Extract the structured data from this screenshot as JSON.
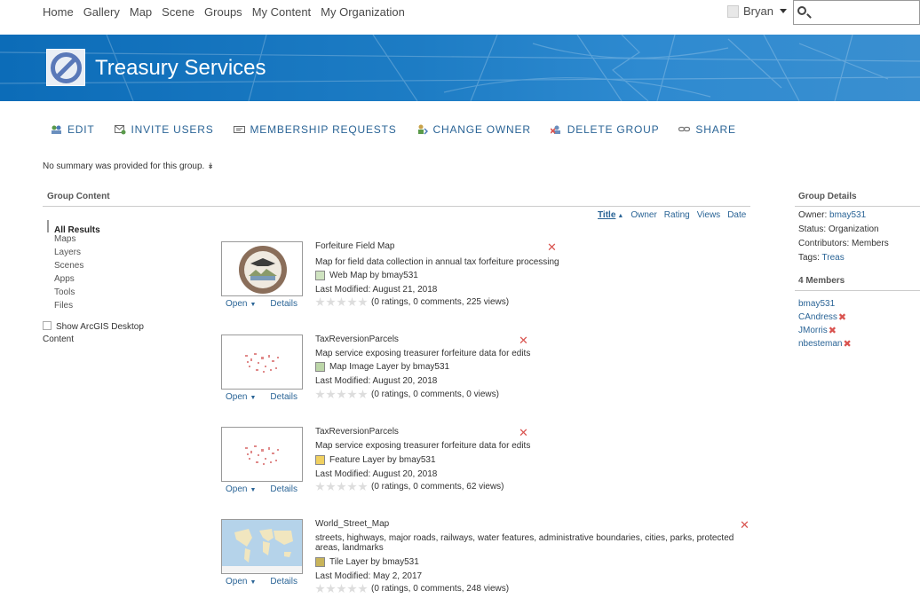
{
  "nav": {
    "links": [
      "Home",
      "Gallery",
      "Map",
      "Scene",
      "Groups",
      "My Content",
      "My Organization"
    ],
    "user": "Bryan",
    "search_value": ""
  },
  "banner": {
    "title": "Treasury Services",
    "color": "#1d7cc4"
  },
  "actions": [
    {
      "label": "EDIT",
      "icon": "edit-icon"
    },
    {
      "label": "INVITE USERS",
      "icon": "invite-icon"
    },
    {
      "label": "MEMBERSHIP REQUESTS",
      "icon": "requests-icon"
    },
    {
      "label": "CHANGE OWNER",
      "icon": "change-owner-icon"
    },
    {
      "label": "DELETE GROUP",
      "icon": "delete-group-icon"
    },
    {
      "label": "SHARE",
      "icon": "share-icon"
    }
  ],
  "summary": "No summary was provided for this group.",
  "group_content": {
    "heading": "Group Content",
    "filter_active": "All Results",
    "filters": [
      "Maps",
      "Layers",
      "Scenes",
      "Apps",
      "Tools",
      "Files"
    ],
    "show_desktop": "Show ArcGIS Desktop Content",
    "sort": [
      "Title",
      "Owner",
      "Rating",
      "Views",
      "Date"
    ]
  },
  "items": [
    {
      "title": "Forfeiture Field Map",
      "description": "Map for field data collection in annual tax forfeiture processing",
      "type": "Web Map by bmay531",
      "modified": "Last Modified: August 21, 2018",
      "ratings": "(0 ratings, 0 comments, 225 views)",
      "open": "Open",
      "details": "Details",
      "thumb_icon": "county-seal-thumbnail"
    },
    {
      "title": "TaxReversionParcels",
      "description": "Map service exposing treasurer forfeiture data for edits",
      "type": "Map Image Layer by bmay531",
      "modified": "Last Modified: August 20, 2018",
      "ratings": "(0 ratings, 0 comments, 0 views)",
      "open": "Open",
      "details": "Details",
      "thumb_icon": "parcels-thumbnail"
    },
    {
      "title": "TaxReversionParcels",
      "description": "Map service exposing treasurer forfeiture data for edits",
      "type": "Feature Layer by bmay531",
      "modified": "Last Modified: August 20, 2018",
      "ratings": "(0 ratings, 0 comments, 62 views)",
      "open": "Open",
      "details": "Details",
      "thumb_icon": "parcels-thumbnail"
    },
    {
      "title": "World_Street_Map",
      "description": "streets, highways, major roads, railways, water features, administrative boundaries, cities, parks, protected areas, landmarks",
      "type": "Tile Layer by bmay531",
      "modified": "Last Modified: May 2, 2017",
      "ratings": "(0 ratings, 0 comments, 248 views)",
      "open": "Open",
      "details": "Details",
      "thumb_icon": "world-map-thumbnail"
    }
  ],
  "details": {
    "heading": "Group Details",
    "owner_label": "Owner:",
    "owner": "bmay531",
    "status": "Status: Organization",
    "contributors": "Contributors: Members",
    "tags_label": "Tags:",
    "tags": "Treas",
    "members_heading": "4 Members",
    "members": [
      {
        "name": "bmay531",
        "removable": false
      },
      {
        "name": "CAndress",
        "removable": true
      },
      {
        "name": "JMorris",
        "removable": true
      },
      {
        "name": "nbesteman",
        "removable": true
      }
    ]
  },
  "colors": {
    "link": "#2a6496",
    "delete": "#d9534f"
  }
}
